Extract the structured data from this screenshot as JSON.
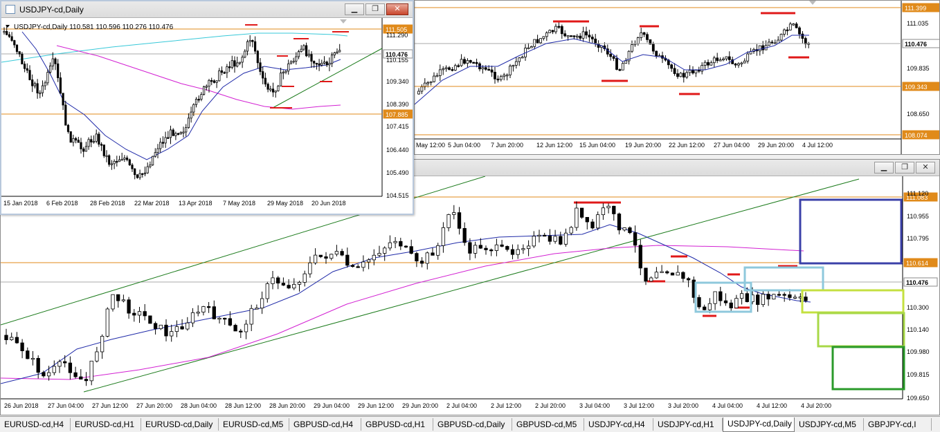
{
  "colors": {
    "candle_up": "#ffffff",
    "candle_down": "#000000",
    "ma_blue": "#1f2aa8",
    "ma_magenta": "#d21fd2",
    "ma_cyan": "#36c8d8",
    "level_orange": "#e08a1a",
    "mark_red": "#e01818",
    "trend_green": "#1a7a1a"
  },
  "win_h4": {
    "axis": [
      "111.035",
      "109.835",
      "108.650"
    ],
    "levels": [
      {
        "label": "111.399",
        "type": "orange"
      },
      {
        "label": "110.476",
        "type": "current"
      },
      {
        "label": "109.343",
        "type": "orange"
      },
      {
        "label": "108.074",
        "type": "orange"
      }
    ],
    "times": [
      "May 12:00",
      "5 Jun 04:00",
      "7 Jun 20:00",
      "12 Jun 12:00",
      "15 Jun 04:00",
      "19 Jun 20:00",
      "22 Jun 12:00",
      "27 Jun 04:00",
      "29 Jun 20:00",
      "4 Jul 12:00"
    ]
  },
  "win_daily": {
    "title": "USDJPY-cd,Daily",
    "header": "USDJPY-cd,Daily  110.581 110.596 110.276 110.476",
    "axis": [
      "111.290",
      "110.155",
      "109.340",
      "108.390",
      "107.415",
      "106.440",
      "105.490",
      "104.515"
    ],
    "levels": [
      {
        "label": "111.505",
        "type": "orange"
      },
      {
        "label": "110.476",
        "type": "current"
      },
      {
        "label": "107.885",
        "type": "orange"
      }
    ],
    "times": [
      "15 Jan 2018",
      "6 Feb 2018",
      "28 Feb 2018",
      "22 Mar 2018",
      "13 Apr 2018",
      "7 May 2018",
      "29 May 2018",
      "20 Jun 2018"
    ],
    "buttons": {
      "minimize": "▁",
      "maximize": "❐",
      "close": "✕"
    }
  },
  "win_m5": {
    "axis": [
      "111.120",
      "110.955",
      "110.795",
      "110.300",
      "110.140",
      "109.980",
      "109.815",
      "109.650"
    ],
    "levels": [
      {
        "label": "111.083",
        "type": "orange"
      },
      {
        "label": "110.614",
        "type": "orange"
      },
      {
        "label": "110.476",
        "type": "current"
      }
    ],
    "times": [
      "26 Jun 2018",
      "27 Jun 04:00",
      "27 Jun 12:00",
      "27 Jun 20:00",
      "28 Jun 04:00",
      "28 Jun 12:00",
      "28 Jun 20:00",
      "29 Jun 04:00",
      "29 Jun 12:00",
      "29 Jun 20:00",
      "2 Jul 04:00",
      "2 Jul 12:00",
      "2 Jul 20:00",
      "3 Jul 04:00",
      "3 Jul 12:00",
      "3 Jul 20:00",
      "4 Jul 04:00",
      "4 Jul 12:00",
      "4 Jul 20:00"
    ],
    "buttons": {
      "minimize": "▁",
      "maximize": "❐",
      "close": "✕"
    }
  },
  "tabs": [
    "EURUSD-cd,H4",
    "EURUSD-cd,H1",
    "EURUSD-cd,Daily",
    "EURUSD-cd,M5",
    "GBPUSD-cd,H4",
    "GBPUSD-cd,H1",
    "GBPUSD-cd,Daily",
    "GBPUSD-cd,M5",
    "USDJPY-cd,H4",
    "USDJPY-cd,H1",
    "USDJPY-cd,Daily",
    "USDJPY-cd,M5",
    "GBPJPY-cd,I"
  ],
  "active_tab": "USDJPY-cd,Daily"
}
